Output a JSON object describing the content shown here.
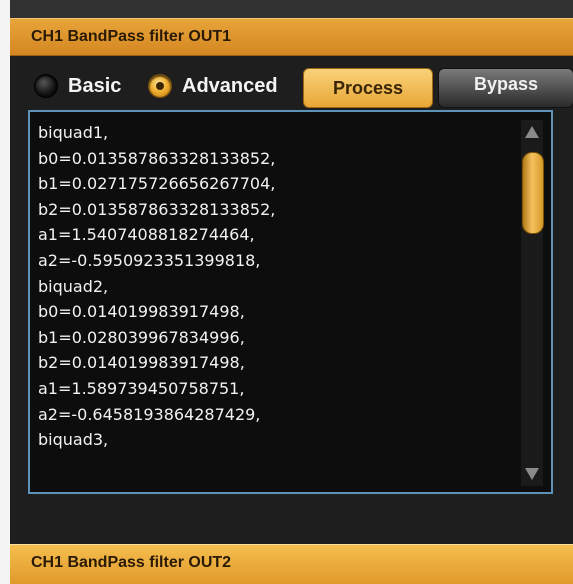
{
  "panel1": {
    "title": "CH1 BandPass filter OUT1"
  },
  "mode": {
    "basic_label": "Basic",
    "advanced_label": "Advanced",
    "selected": "Advanced"
  },
  "buttons": {
    "process_label": "Process",
    "bypass_label": "Bypass"
  },
  "coefficients": {
    "lines": [
      "biquad1,",
      "b0=0.013587863328133852,",
      "b1=0.027175726656267704,",
      "b2=0.013587863328133852,",
      "a1=1.5407408818274464,",
      "a2=-0.5950923351399818,",
      "biquad2,",
      "b0=0.014019983917498,",
      "b1=0.028039967834996,",
      "b2=0.014019983917498,",
      "a1=1.589739450758751,",
      "a2=-0.6458193864287429,",
      "biquad3,"
    ]
  },
  "panel2": {
    "title": "CH1 BandPass filter OUT2"
  },
  "colors": {
    "accent": "#e09a2b",
    "focus_border": "#5d93b8"
  }
}
